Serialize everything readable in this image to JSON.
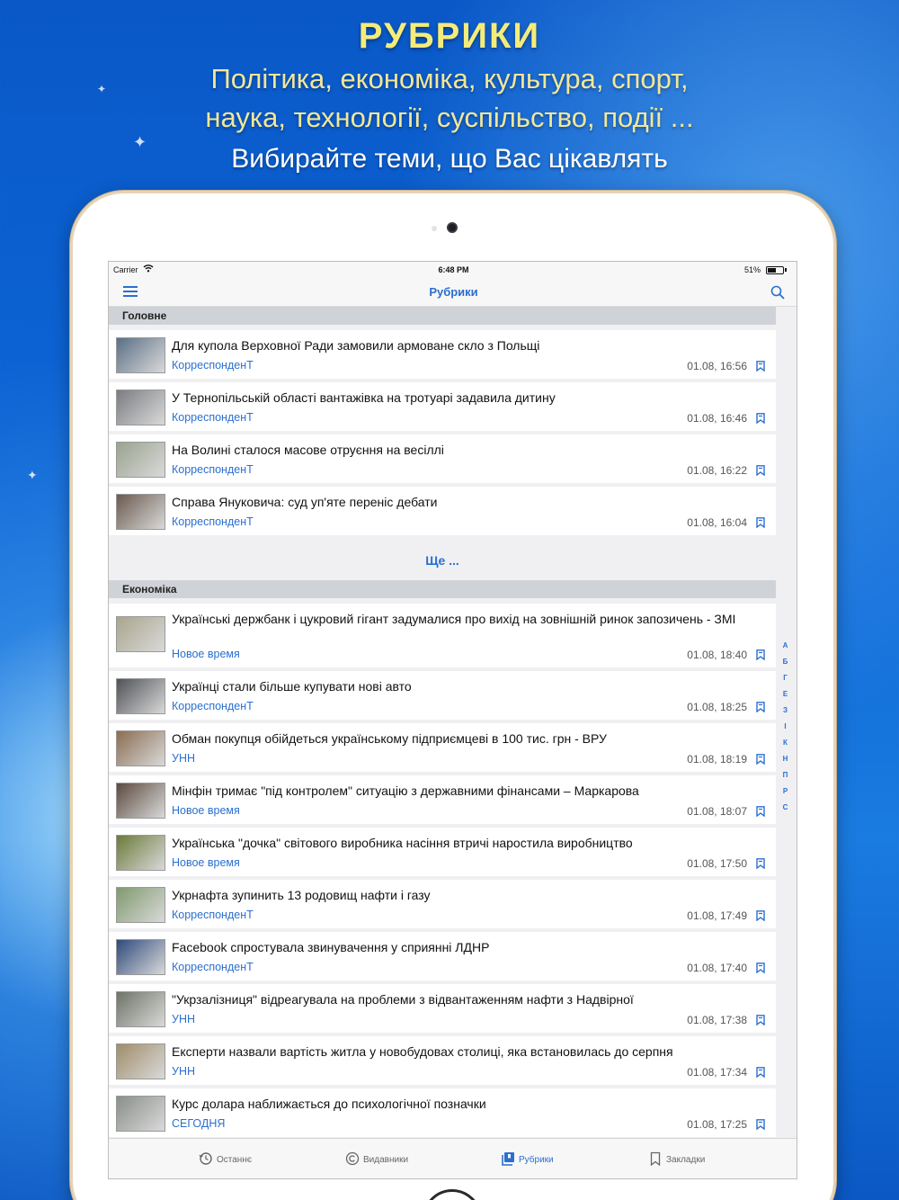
{
  "promo": {
    "title": "РУБРИКИ",
    "line1": "Політика, економіка, культура, спорт,",
    "line2": "наука, технології, суспільство, події ...",
    "subtitle": "Вибирайте теми, що Вас цікавлять"
  },
  "status_bar": {
    "carrier": "Carrier",
    "time": "6:48 PM",
    "battery": "51%"
  },
  "nav": {
    "title": "Рубрики",
    "menu_icon": "menu-icon",
    "search_icon": "search-icon"
  },
  "sections": [
    {
      "title": "Головне",
      "items": [
        {
          "title": "Для купола Верховної Ради замовили армоване скло з Польщі",
          "source": "КорреспонденТ",
          "time": "01.08, 16:56",
          "thumb_color": "#5a6f86"
        },
        {
          "title": "У Тернопільській області вантажівка на тротуарі задавила дитину",
          "source": "КорреспонденТ",
          "time": "01.08, 16:46",
          "thumb_color": "#7b7d82"
        },
        {
          "title": "На Волині сталося масове отруєння на весіллі",
          "source": "КорреспонденТ",
          "time": "01.08, 16:22",
          "thumb_color": "#9aa38f"
        },
        {
          "title": "Справа Януковича: суд уп'яте переніс дебати",
          "source": "КорреспонденТ",
          "time": "01.08, 16:04",
          "thumb_color": "#6b5a4f"
        }
      ],
      "more": "Ще ..."
    },
    {
      "title": "Економіка",
      "items": [
        {
          "title": "Українські держбанк і цукровий гігант задумалися про вихід на зовнішній ринок запозичень - ЗМІ",
          "source": "Новое время",
          "time": "01.08, 18:40",
          "thumb_color": "#a9a58c"
        },
        {
          "title": "Українці стали більше купувати нові авто",
          "source": "КорреспонденТ",
          "time": "01.08, 18:25",
          "thumb_color": "#4f5257"
        },
        {
          "title": "Обман покупця обійдеться українському підприємцеві в 100 тис. грн - ВРУ",
          "source": "УНН",
          "time": "01.08, 18:19",
          "thumb_color": "#8b6d52"
        },
        {
          "title": "Мінфін тримає \"під контролем\" ситуацію з державними фінансами – Маркарова",
          "source": "Новое время",
          "time": "01.08, 18:07",
          "thumb_color": "#5c4a3f"
        },
        {
          "title": "Українська \"дочка\" світового виробника насіння втричі наростила виробництво",
          "source": "Новое время",
          "time": "01.08, 17:50",
          "thumb_color": "#6b7a3a"
        },
        {
          "title": "Укрнафта зупинить 13 родовищ нафти і газу",
          "source": "КорреспонденТ",
          "time": "01.08, 17:49",
          "thumb_color": "#7f9a6e"
        },
        {
          "title": "Facebook спростувала звинувачення у сприянні ЛДНР",
          "source": "КорреспонденТ",
          "time": "01.08, 17:40",
          "thumb_color": "#2e4a7d"
        },
        {
          "title": "\"Укрзалізниця\" відреагувала на проблеми з відвантаженням нафти з Надвірної",
          "source": "УНН",
          "time": "01.08, 17:38",
          "thumb_color": "#6e7468"
        },
        {
          "title": "Експерти назвали вартість житла у новобудовах столиці, яка встановилась до серпня",
          "source": "УНН",
          "time": "01.08, 17:34",
          "thumb_color": "#a08d6a"
        },
        {
          "title": "Курс долара наближається до психологічної позначки",
          "source": "СЕГОДНЯ",
          "time": "01.08, 17:25",
          "thumb_color": "#8a8f8a"
        }
      ]
    }
  ],
  "index_letters": [
    "А",
    "Б",
    "Г",
    "Е",
    "З",
    "І",
    "К",
    "Н",
    "П",
    "Р",
    "С"
  ],
  "tabs": [
    {
      "label": "Останнє",
      "icon": "history-icon",
      "active": false
    },
    {
      "label": "Видавники",
      "icon": "copyright-icon",
      "active": false
    },
    {
      "label": "Рубрики",
      "icon": "categories-icon",
      "active": true
    },
    {
      "label": "Закладки",
      "icon": "bookmark-icon",
      "active": false
    }
  ],
  "colors": {
    "accent": "#2a6fd0",
    "promo_title": "#f4ec7a",
    "background": "#0d66d6"
  }
}
